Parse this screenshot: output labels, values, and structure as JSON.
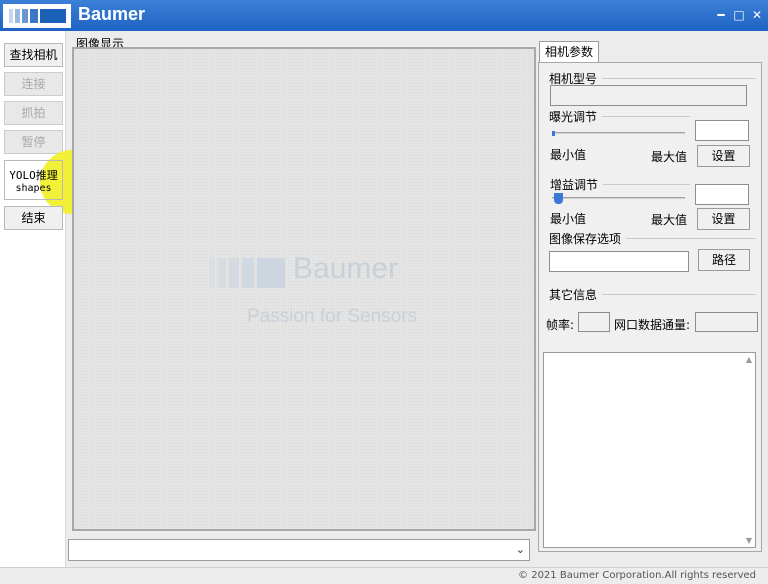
{
  "window": {
    "title": "Baumer",
    "controls": {
      "minimize": "━",
      "maximize": "□",
      "close": "✕"
    }
  },
  "left_panel": {
    "find_camera": "查找相机",
    "connect": "连接",
    "capture": "抓拍",
    "pause": "暂停",
    "yolo_line1": "YOLO推理",
    "yolo_line2": "shapes",
    "end": "结束"
  },
  "image_display": {
    "group_label": "图像显示",
    "watermark_brand": "Baumer",
    "watermark_tagline": "Passion for Sensors",
    "log_combo_value": ""
  },
  "camera_params": {
    "tab_label": "相机参数",
    "model_group": "相机型号",
    "model_value": "",
    "exposure_group": "曝光调节",
    "exposure_min_label": "最小值",
    "exposure_max_label": "最大值",
    "exposure_value": "",
    "exposure_set": "设置",
    "gain_group": "增益调节",
    "gain_min_label": "最小值",
    "gain_max_label": "最大值",
    "gain_value": "",
    "gain_set": "设置",
    "save_group": "图像保存选项",
    "save_path_value": "",
    "path_button": "路径",
    "other_group": "其它信息",
    "fps_label": "帧率:",
    "fps_value": "",
    "bandwidth_label": "网口数据通量:",
    "bandwidth_value": "",
    "info_text": ""
  },
  "status_bar": {
    "copyright": "© 2021 Baumer Corporation.All rights reserved"
  },
  "colors": {
    "titlebar": "#2a6fd0",
    "cursor_highlight": "#f0f028",
    "slider_thumb": "#3a7ad6"
  },
  "icons": {
    "logo": "baumer-logo-icon",
    "cursor": "mouse-cursor-icon",
    "combo_arrow": "chevron-down-icon"
  }
}
